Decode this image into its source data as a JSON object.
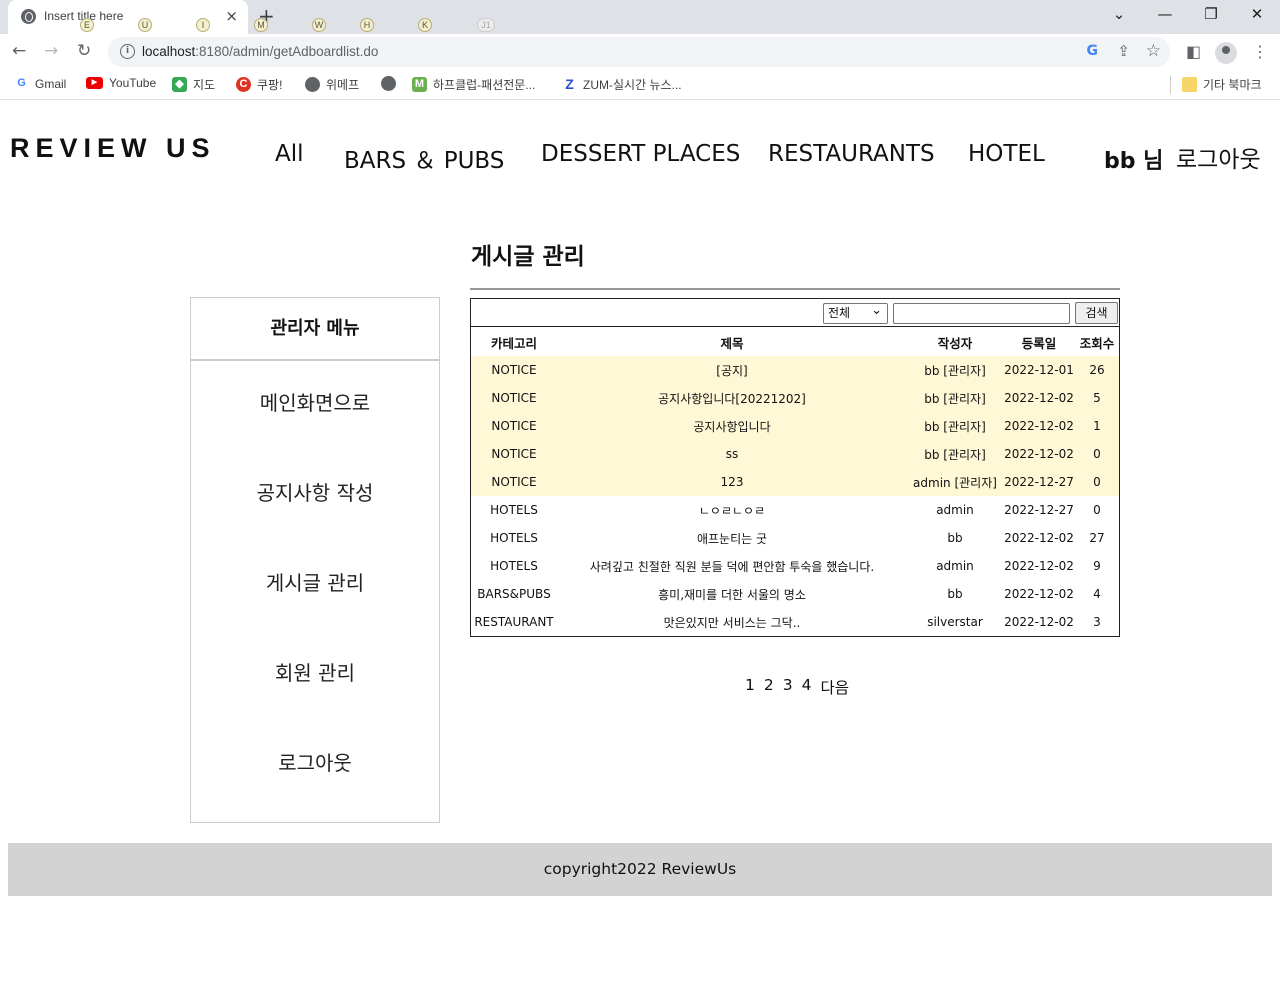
{
  "browser": {
    "tab_title": "Insert title here",
    "tab_close": "×",
    "new_tab": "+",
    "kbd_hints": [
      "E",
      "U",
      "I",
      "M",
      "W",
      "H",
      "K",
      "J1"
    ],
    "url_host": "localhost",
    "url_rest": ":8180/admin/getAdboardlist.do",
    "google_icon": "G",
    "bookmarks": [
      "Gmail",
      "YouTube",
      "지도",
      "쿠팡!",
      "위메프",
      "",
      "하프클럽-패션전문...",
      "ZUM-실시간 뉴스...",
      "기타 북마크"
    ]
  },
  "site": {
    "logo": "REVIEW US",
    "nav": [
      "All",
      "BARS ＆ PUBS",
      "DESSERT PLACES",
      "RESTAURANTS",
      "HOTEL"
    ],
    "user_name": "bb",
    "user_suffix": "님",
    "logout": "로그아웃"
  },
  "sidebar": {
    "title": "관리자 메뉴",
    "items": [
      "메인화면으로",
      "공지사항 작성",
      "게시글 관리",
      "회원 관리",
      "로그아웃"
    ]
  },
  "main": {
    "heading": "게시글 관리",
    "search_select": "전체",
    "search_button": "검색",
    "columns": [
      "카테고리",
      "제목",
      "작성자",
      "등록일",
      "조회수"
    ],
    "rows": [
      {
        "category": "NOTICE",
        "title": "[공지]",
        "writer": "bb [관리자]",
        "date": "2022-12-01",
        "views": "26",
        "notice": true
      },
      {
        "category": "NOTICE",
        "title": "공지사항입니다[20221202]",
        "writer": "bb [관리자]",
        "date": "2022-12-02",
        "views": "5",
        "notice": true
      },
      {
        "category": "NOTICE",
        "title": "공지사항입니다",
        "writer": "bb [관리자]",
        "date": "2022-12-02",
        "views": "1",
        "notice": true
      },
      {
        "category": "NOTICE",
        "title": "ss",
        "writer": "bb [관리자]",
        "date": "2022-12-02",
        "views": "0",
        "notice": true
      },
      {
        "category": "NOTICE",
        "title": "123",
        "writer": "admin [관리자]",
        "date": "2022-12-27",
        "views": "0",
        "notice": true
      },
      {
        "category": "HOTELS",
        "title": "ㄴㅇㄹㄴㅇㄹ",
        "writer": "admin",
        "date": "2022-12-27",
        "views": "0",
        "notice": false
      },
      {
        "category": "HOTELS",
        "title": "애프눈티는 굿",
        "writer": "bb",
        "date": "2022-12-02",
        "views": "27",
        "notice": false
      },
      {
        "category": "HOTELS",
        "title": "사려깊고 친절한 직원 분들 덕에 편안함 투숙을 했습니다.",
        "writer": "admin",
        "date": "2022-12-02",
        "views": "9",
        "notice": false
      },
      {
        "category": "BARS&PUBS",
        "title": "흥미,재미를 더한 서울의 명소",
        "writer": "bb",
        "date": "2022-12-02",
        "views": "4",
        "notice": false
      },
      {
        "category": "RESTAURANT",
        "title": "맛은있지만 서비스는 그닥..",
        "writer": "silverstar",
        "date": "2022-12-02",
        "views": "3",
        "notice": false
      }
    ],
    "pages": [
      "1",
      "2",
      "3",
      "4",
      "다음"
    ]
  },
  "footer": {
    "text": "copyright2022 ReviewUs"
  }
}
